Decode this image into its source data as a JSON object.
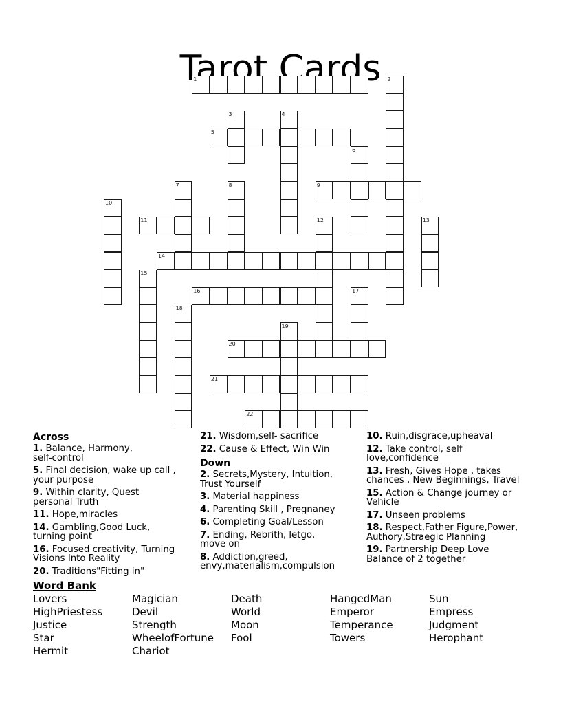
{
  "title": "Tarot Cards",
  "puzzle": {
    "words": [
      {
        "number": "1",
        "direction": "across",
        "row": 0,
        "col": 5,
        "length": 10
      },
      {
        "number": "2",
        "direction": "down",
        "row": 0,
        "col": 16,
        "length": 13
      },
      {
        "number": "3",
        "direction": "down",
        "row": 2,
        "col": 7,
        "length": 3
      },
      {
        "number": "4",
        "direction": "down",
        "row": 2,
        "col": 10,
        "length": 7
      },
      {
        "number": "5",
        "direction": "across",
        "row": 3,
        "col": 6,
        "length": 8
      },
      {
        "number": "6",
        "direction": "down",
        "row": 4,
        "col": 14,
        "length": 5
      },
      {
        "number": "7",
        "direction": "down",
        "row": 6,
        "col": 4,
        "length": 5
      },
      {
        "number": "8",
        "direction": "down",
        "row": 6,
        "col": 7,
        "length": 5
      },
      {
        "number": "9",
        "direction": "across",
        "row": 6,
        "col": 12,
        "length": 6
      },
      {
        "number": "10",
        "direction": "down",
        "row": 7,
        "col": 0,
        "length": 6
      },
      {
        "number": "11",
        "direction": "across",
        "row": 8,
        "col": 2,
        "length": 4
      },
      {
        "number": "12",
        "direction": "down",
        "row": 8,
        "col": 12,
        "length": 8
      },
      {
        "number": "13",
        "direction": "down",
        "row": 8,
        "col": 18,
        "length": 4
      },
      {
        "number": "14",
        "direction": "across",
        "row": 10,
        "col": 3,
        "length": 14
      },
      {
        "number": "15",
        "direction": "down",
        "row": 11,
        "col": 2,
        "length": 7
      },
      {
        "number": "16",
        "direction": "across",
        "row": 12,
        "col": 5,
        "length": 8
      },
      {
        "number": "17",
        "direction": "down",
        "row": 12,
        "col": 14,
        "length": 4
      },
      {
        "number": "18",
        "direction": "down",
        "row": 13,
        "col": 4,
        "length": 7
      },
      {
        "number": "19",
        "direction": "down",
        "row": 14,
        "col": 10,
        "length": 6
      },
      {
        "number": "20",
        "direction": "across",
        "row": 15,
        "col": 7,
        "length": 9
      },
      {
        "number": "21",
        "direction": "across",
        "row": 17,
        "col": 6,
        "length": 9
      },
      {
        "number": "22",
        "direction": "across",
        "row": 19,
        "col": 8,
        "length": 7
      }
    ]
  },
  "clues": {
    "across_heading": "Across",
    "down_heading": "Down",
    "across": [
      {
        "number": "1.",
        "text": "Balance, Harmony, self-control"
      },
      {
        "number": "5.",
        "text": "Final decision, wake up call , your purpose"
      },
      {
        "number": "9.",
        "text": "Within clarity, Quest personal Truth"
      },
      {
        "number": "11.",
        "text": "Hope,miracles"
      },
      {
        "number": "14.",
        "text": "Gambling,Good Luck, turning point"
      },
      {
        "number": "16.",
        "text": "Focused creativity, Turning Visions Into Reality"
      },
      {
        "number": "20.",
        "text": "Traditions\"Fitting in\""
      },
      {
        "number": "21.",
        "text": "Wisdom,self- sacrifice"
      },
      {
        "number": "22.",
        "text": "Cause & Effect, Win Win"
      }
    ],
    "down": [
      {
        "number": "2.",
        "text": "Secrets,Mystery, Intuition, Trust Yourself"
      },
      {
        "number": "3.",
        "text": "Material happiness"
      },
      {
        "number": "4.",
        "text": "Parenting Skill , Pregnaney"
      },
      {
        "number": "6.",
        "text": "Completing Goal/Lesson"
      },
      {
        "number": "7.",
        "text": "Ending, Rebrith, letgo, move on"
      },
      {
        "number": "8.",
        "text": "Addiction,greed, envy,materialism,compulsion"
      },
      {
        "number": "10.",
        "text": "Ruin,disgrace,upheaval"
      },
      {
        "number": "12.",
        "text": "Take control, self love,confidence"
      },
      {
        "number": "13.",
        "text": "Fresh, Gives Hope , takes chances , New Beginnings, Travel"
      },
      {
        "number": "15.",
        "text": "Action & Change journey or Vehicle"
      },
      {
        "number": "17.",
        "text": "Unseen problems"
      },
      {
        "number": "18.",
        "text": "Respect,Father Figure,Power, Authory,Straegic Planning"
      },
      {
        "number": "19.",
        "text": "Partnership Deep Love Balance of 2 together"
      }
    ]
  },
  "word_bank": {
    "heading": "Word Bank",
    "words": [
      "Lovers",
      "Magician",
      "Death",
      "HangedMan",
      "Sun",
      "HighPriestess",
      "Devil",
      "World",
      "Emperor",
      "Empress",
      "Justice",
      "Strength",
      "Moon",
      "Temperance",
      "Judgment",
      "Star",
      "WheelofFortune",
      "Fool",
      "Towers",
      "Herophant",
      "Hermit",
      "Chariot"
    ]
  }
}
